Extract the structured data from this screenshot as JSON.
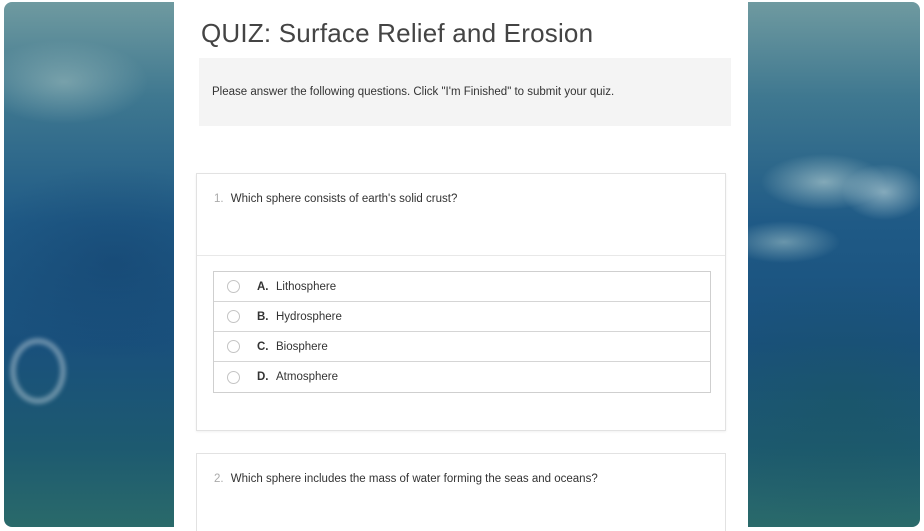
{
  "quiz": {
    "title": "QUIZ: Surface Relief and Erosion",
    "instructions": "Please answer the following questions. Click \"I'm Finished\" to submit your quiz."
  },
  "questions": [
    {
      "number": "1.",
      "text": "Which sphere consists of earth's solid crust?",
      "options": [
        {
          "letter": "A.",
          "label": "Lithosphere"
        },
        {
          "letter": "B.",
          "label": "Hydrosphere"
        },
        {
          "letter": "C.",
          "label": "Biosphere"
        },
        {
          "letter": "D.",
          "label": "Atmosphere"
        }
      ]
    },
    {
      "number": "2.",
      "text": "Which sphere includes the mass of water forming the seas and oceans?"
    }
  ]
}
